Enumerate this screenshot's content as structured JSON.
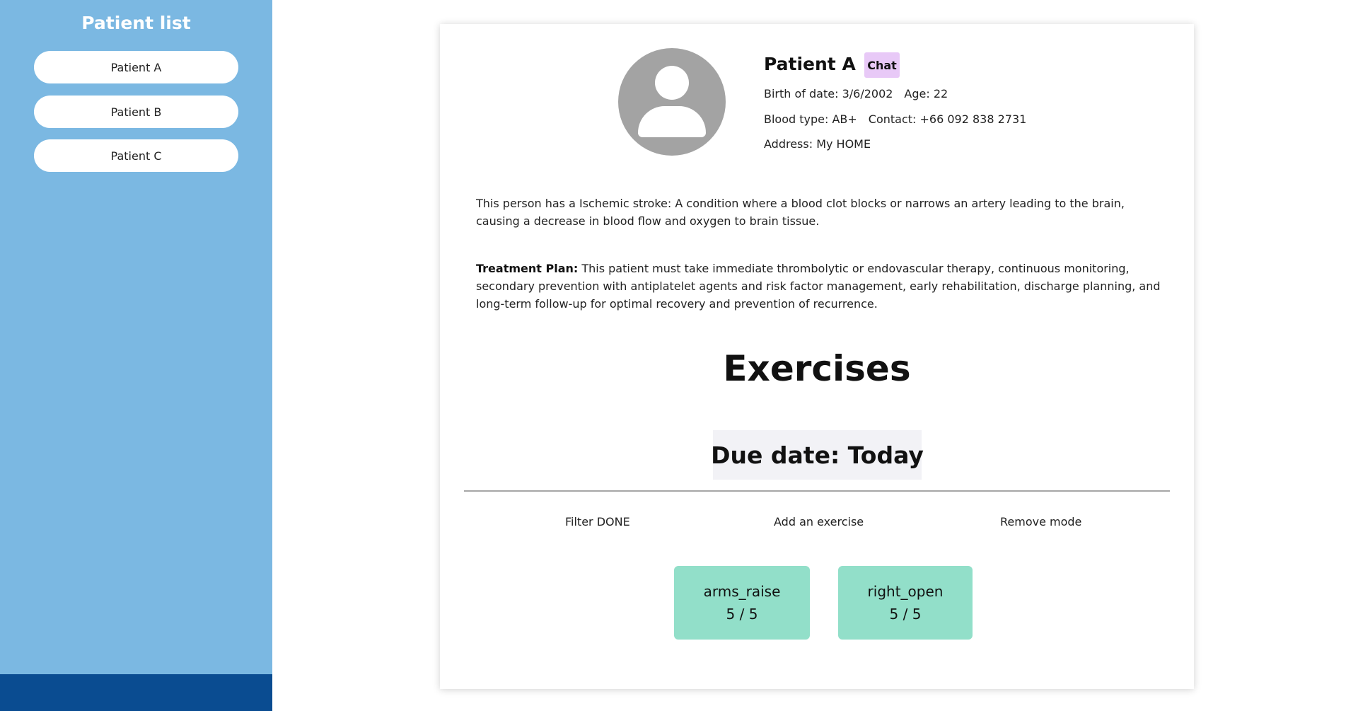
{
  "sidebar": {
    "title": "Patient list",
    "patients": [
      "Patient A",
      "Patient B",
      "Patient C"
    ]
  },
  "patient": {
    "name": "Patient A",
    "chat_label": "Chat",
    "birth": "Birth of date: 3/6/2002",
    "age": "Age: 22",
    "blood": "Blood type: AB+",
    "contact": "Contact: +66 092 838 2731",
    "address": "Address: My HOME"
  },
  "condition": "This person has a Ischemic stroke: A condition where a blood clot blocks or narrows an artery leading to the brain, causing a decrease in blood flow and oxygen to brain tissue.",
  "treatment": {
    "label": "Treatment Plan:",
    "text": " This patient must take immediate thrombolytic or endovascular therapy, continuous monitoring, secondary prevention with antiplatelet agents and risk factor management, early rehabilitation, discharge planning, and long-term follow-up for optimal recovery and prevention of recurrence."
  },
  "exercises": {
    "title": "Exercises",
    "due": "Due date: Today",
    "actions": [
      "Filter DONE",
      "Add an exercise",
      "Remove mode"
    ],
    "items": [
      {
        "name": "arms_raise",
        "progress": "5 / 5"
      },
      {
        "name": "right_open",
        "progress": "5 / 5"
      }
    ]
  },
  "colors": {
    "sidebar": "#7bb8e2",
    "sidebar_footer": "#0a4c91",
    "chat_badge": "#e8c9f7",
    "exercise_tile": "#92dfc9"
  }
}
